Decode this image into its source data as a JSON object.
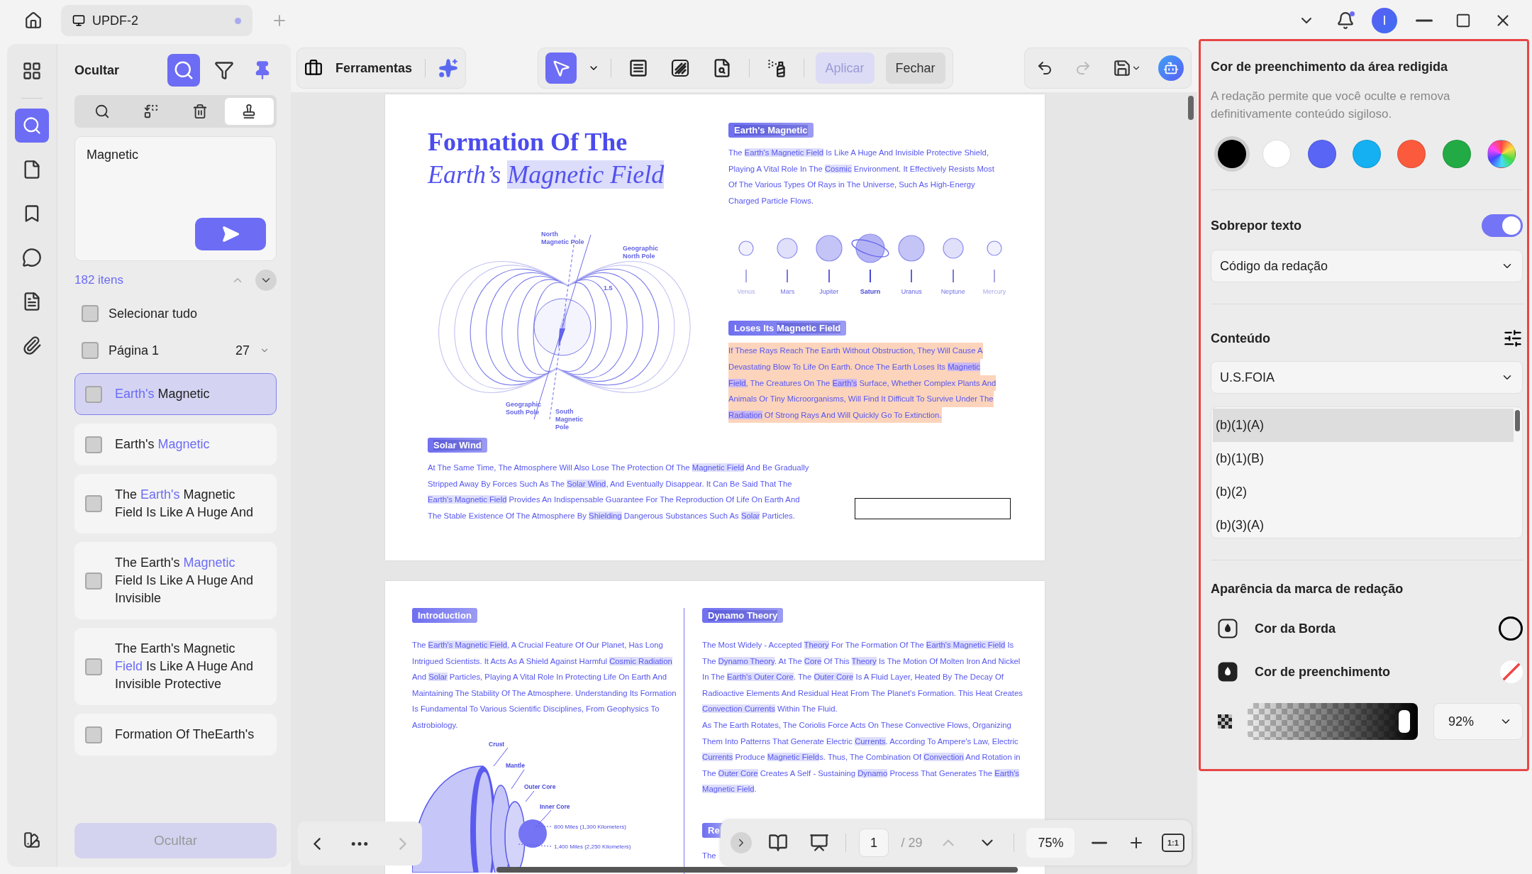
{
  "tab": {
    "title": "UPDF-2"
  },
  "avatar": {
    "initial": "I"
  },
  "rail": {
    "items": [
      {
        "kind": "apps",
        "selected": false
      },
      {
        "kind": "search",
        "selected": true
      },
      {
        "kind": "pages",
        "selected": false
      },
      {
        "kind": "bookmark",
        "selected": false
      },
      {
        "kind": "comment",
        "selected": false
      },
      {
        "kind": "form",
        "selected": false
      },
      {
        "kind": "attachment",
        "selected": false
      }
    ]
  },
  "search_panel": {
    "title": "Ocultar",
    "smart_search": {
      "selected": true
    },
    "filter": {
      "selected": false
    },
    "pin": {
      "on": true
    },
    "modes": [
      {
        "kind": "search",
        "selected": false
      },
      {
        "kind": "replace",
        "selected": false
      },
      {
        "kind": "delete",
        "selected": false
      },
      {
        "kind": "redact",
        "selected": true
      }
    ],
    "query": {
      "value": "Magnetic"
    },
    "count": "182 itens",
    "select_all": {
      "label": "Selecionar tudo",
      "checked": false
    },
    "page_group": {
      "label": "Página 1",
      "count": "27",
      "checked": false
    },
    "results": [
      {
        "selected": true,
        "checked": false,
        "parts": [
          {
            "t": "Earth's",
            "hl": true
          },
          " Magnetic"
        ]
      },
      {
        "selected": false,
        "checked": false,
        "parts": [
          "Earth's ",
          {
            "t": "Magnetic",
            "hl": true
          }
        ]
      },
      {
        "selected": false,
        "checked": false,
        "parts": [
          "The ",
          {
            "t": "Earth's",
            "hl": true
          },
          " Magnetic Field Is Like A Huge And"
        ]
      },
      {
        "selected": false,
        "checked": false,
        "parts": [
          "The Earth's ",
          {
            "t": "Magnetic",
            "hl": true
          },
          " Field Is Like A Huge And Invisible"
        ]
      },
      {
        "selected": false,
        "checked": false,
        "parts": [
          "The Earth's Magnetic ",
          {
            "t": "Field",
            "hl": true
          },
          " Is Like A Huge And Invisible Protective"
        ]
      },
      {
        "selected": false,
        "checked": false,
        "parts": [
          "Formation Of TheEarth's"
        ]
      }
    ],
    "hide_button": {
      "label": "Ocultar",
      "disabled": true
    }
  },
  "toolbar": {
    "tools_label": "Ferramentas",
    "tools": [
      {
        "kind": "select",
        "selected": true
      },
      {
        "kind": "area",
        "selected": false
      },
      {
        "kind": "pattern",
        "selected": false
      },
      {
        "kind": "find",
        "selected": false
      },
      {
        "kind": "sanitize",
        "selected": false
      }
    ],
    "apply": {
      "label": "Aplicar",
      "disabled": true
    },
    "close": {
      "label": "Fechar",
      "disabled": false
    },
    "undo": {
      "disabled": false
    },
    "redo": {
      "disabled": true
    }
  },
  "page_1": {
    "title": "Formation Of The",
    "subtitle": [
      "Earth’s ",
      {
        "t": "Magnetic ",
        "hl": true
      },
      {
        "t": "Field",
        "hl": true
      }
    ],
    "field_labels": [
      [
        "North",
        "Magnetic Pole"
      ],
      [
        "Geographic",
        "North Pole"
      ],
      [
        "1.5"
      ],
      [
        "Geographic",
        "South Pole"
      ],
      [
        "South",
        "Magnetic",
        "Pole"
      ]
    ],
    "planets": [
      {
        "name": "Venus",
        "kind": "small"
      },
      {
        "name": "Mars",
        "kind": "medium"
      },
      {
        "name": "Jupiter",
        "kind": "large"
      },
      {
        "name": "Saturn",
        "kind": "ringed"
      },
      {
        "name": "Uranus",
        "kind": "large"
      },
      {
        "name": "Neptune",
        "kind": "medium"
      },
      {
        "name": "Mercury",
        "kind": "small"
      }
    ],
    "sections": [
      {
        "heading": [
          {
            "t": "Earth's ",
            "hl": true
          },
          {
            "t": "Magnetic",
            "hl": true
          }
        ],
        "highlighted": false,
        "lines": [
          [
            "The ",
            {
              "t": "Earth's ",
              "hl": true
            },
            {
              "t": "Magnetic ",
              "hl": true
            },
            {
              "t": "Field",
              "hl": true
            },
            " Is Like A Huge And Invisible Protective Shield,"
          ],
          [
            "Playing A Vital Role In The ",
            {
              "t": "Cosmic",
              "hl": true
            },
            " Environment. It Effectively Resists Most"
          ],
          [
            "Of The Various Types Of Rays in The Universe, Such As High-Energy"
          ],
          [
            "Charged Particle Flows."
          ]
        ]
      },
      {
        "heading": [
          "Loses Its ",
          {
            "t": "Magnetic ",
            "hl": true
          },
          {
            "t": "Field",
            "hl": true
          }
        ],
        "highlighted": true,
        "lines": [
          [
            "If These Rays Reach The Earth Without Obstruction, They Will Cause A"
          ],
          [
            "Devastating Blow To Life On Earth. Once The Earth Loses Its ",
            {
              "t": "Magnetic",
              "hl": true
            }
          ],
          [
            {
              "t": "Field",
              "hl": true
            },
            ", The Creatures On The ",
            {
              "t": "Earth's",
              "hl": true
            },
            " Surface, Whether Complex Plants And"
          ],
          [
            "Animals Or Tiny Microorganisms, Will Find It Difficult To Survive Under The"
          ],
          [
            {
              "t": "Radiation",
              "hl": true
            },
            " Of Strong Rays And Will Quickly Go To Extinction."
          ]
        ]
      },
      {
        "heading": [
          {
            "t": "Solar ",
            "hl": true
          },
          {
            "t": "Wind",
            "hl": true
          }
        ],
        "highlighted": false,
        "lines": [
          [
            "At The Same Time, The Atmosphere Will Also Lose The Protection Of The ",
            {
              "t": "Magnetic ",
              "hl": true
            },
            {
              "t": "Field",
              "hl": true
            },
            " And Be Gradually"
          ],
          [
            "Stripped Away By Forces Such As The ",
            {
              "t": "Solar ",
              "hl": true
            },
            {
              "t": "Wind",
              "hl": true
            },
            ", And Eventually Disappear. It Can Be Said That The"
          ],
          [
            {
              "t": "Earth's ",
              "hl": true
            },
            {
              "t": "Magnetic ",
              "hl": true
            },
            {
              "t": "Field",
              "hl": true
            },
            " Provides An Indispensable Guarantee For The Reproduction Of Life On Earth And"
          ],
          [
            "The Stable Existence Of The Atmosphere By ",
            {
              "t": "Shielding",
              "hl": true
            },
            " Dangerous Substances Such As ",
            {
              "t": "Solar",
              "hl": true
            },
            " Particles."
          ]
        ]
      }
    ]
  },
  "page_2": {
    "layer_labels": [
      "Crust",
      "Mantle",
      "Outer Core",
      "Inner Core",
      "800 Miles (1,300 Kilometers)",
      "1,400 Miles (2,250 Kilometers)"
    ],
    "sections": [
      {
        "heading": [
          "Introduction"
        ],
        "highlighted": false,
        "lines": [
          [
            "The ",
            {
              "t": "Earth's ",
              "hl": true
            },
            {
              "t": "Magnetic ",
              "hl": true
            },
            {
              "t": "Field",
              "hl": true
            },
            ", A Crucial Feature Of Our Planet, Has Long"
          ],
          [
            "Intrigued Scientists. It Acts As A Shield Against Harmful ",
            {
              "t": "Cosmic ",
              "hl": true
            },
            {
              "t": "Radiation",
              "hl": true
            }
          ],
          [
            "And ",
            {
              "t": "Solar",
              "hl": true
            },
            " Particles, Playing A Vital Role In Protecting Life On Earth And"
          ],
          [
            "Maintaining The Stability Of The Atmosphere. Understanding Its Formation"
          ],
          [
            "Is Fundamental To Various Scientific Disciplines, From Geophysics To"
          ],
          [
            "Astrobiology."
          ]
        ]
      },
      {
        "heading": [
          {
            "t": "Dynamo ",
            "hl": true
          },
          {
            "t": "Theory",
            "hl": true
          }
        ],
        "highlighted": false,
        "lines": [
          [
            "The Most Widely - Accepted ",
            {
              "t": "Theory",
              "hl": true
            },
            " For The Formation Of The ",
            {
              "t": "Earth's ",
              "hl": true
            },
            {
              "t": "Magnetic ",
              "hl": true
            },
            {
              "t": "Field",
              "hl": true
            },
            " Is"
          ],
          [
            "The ",
            {
              "t": "Dynamo ",
              "hl": true
            },
            {
              "t": "Theory",
              "hl": true
            },
            ". At The ",
            {
              "t": "Core",
              "hl": true
            },
            " Of This ",
            {
              "t": "Theory",
              "hl": true
            },
            " Is The Motion Of Molten Iron And Nickel"
          ],
          [
            "In The ",
            {
              "t": "Earth's ",
              "hl": true
            },
            {
              "t": "Outer ",
              "hl": true
            },
            {
              "t": "Core",
              "hl": true
            },
            ". The ",
            {
              "t": "Outer ",
              "hl": true
            },
            {
              "t": "Core",
              "hl": true
            },
            " Is A Fluid Layer, Heated By The Decay Of"
          ],
          [
            "Radioactive Elements And Residual Heat From The Planet's Formation. This Heat Creates"
          ],
          [
            {
              "t": "Convection ",
              "hl": true
            },
            {
              "t": "Currents",
              "hl": true
            },
            " Within The Fluid."
          ],
          [
            "As The Earth Rotates, The Coriolis Force Acts On These Convective Flows, Organizing"
          ],
          [
            "Them Into Patterns That Generate Electric ",
            {
              "t": "Currents",
              "hl": true
            },
            ". According To Ampere's Law, Electric"
          ],
          [
            {
              "t": "Currents",
              "hl": true
            },
            " Produce ",
            {
              "t": "Magnetic ",
              "hl": true
            },
            {
              "t": "Field",
              "hl": true
            },
            "s. Thus, The Combination Of ",
            {
              "t": "Convection",
              "hl": true
            },
            " And Rotation in"
          ],
          [
            "The ",
            {
              "t": "Outer ",
              "hl": true
            },
            {
              "t": "Core",
              "hl": true
            },
            " Creates A Self - Sustaining ",
            {
              "t": "Dynamo",
              "hl": true
            },
            " Process That Generates The ",
            {
              "t": "Earth's",
              "hl": true
            }
          ],
          [
            {
              "t": "Magnetic ",
              "hl": true
            },
            {
              "t": "Field",
              "hl": true
            },
            "."
          ]
        ]
      },
      {
        "heading": [
          "Re"
        ],
        "highlighted": false,
        "lines": [
          [
            "The"
          ]
        ]
      }
    ]
  },
  "nav": {
    "next_disabled": true,
    "page": "1",
    "total": "/ 29",
    "up_disabled": true,
    "zoom": "75%",
    "actual_size": "1:1"
  },
  "redaction_panel": {
    "title": "Cor de preenchimento da área redigida",
    "description": "A redação permite que você oculte e remova definitivamente conteúdo sigiloso.",
    "swatches": [
      {
        "kind": "solid",
        "color": "#000000",
        "selected": true
      },
      {
        "kind": "solid",
        "color": "#ffffff",
        "selected": false
      },
      {
        "kind": "solid",
        "color": "#5865f5",
        "selected": false
      },
      {
        "kind": "solid",
        "color": "#14b0f2",
        "selected": false
      },
      {
        "kind": "solid",
        "color": "#fb5a3c",
        "selected": false
      },
      {
        "kind": "solid",
        "color": "#22ab45",
        "selected": false
      },
      {
        "kind": "spectrum",
        "selected": false
      }
    ],
    "overlay": {
      "label": "Sobrepor texto",
      "on": true,
      "value": "Código da redação"
    },
    "content": {
      "label": "Conteúdo",
      "value": "U.S.FOIA",
      "codes": [
        {
          "label": "(b)(1)(A)",
          "selected": true
        },
        {
          "label": "(b)(1)(B)",
          "selected": false
        },
        {
          "label": "(b)(2)",
          "selected": false
        },
        {
          "label": "(b)(3)(A)",
          "selected": false
        }
      ]
    },
    "appearance": {
      "title": "Aparência da marca de redação",
      "border": {
        "label": "Cor da Borda",
        "color": "#000000"
      },
      "fill": {
        "label": "Cor de preenchimento",
        "kind": "none"
      },
      "opacity": {
        "level": 0.92,
        "value": "92%"
      }
    }
  }
}
